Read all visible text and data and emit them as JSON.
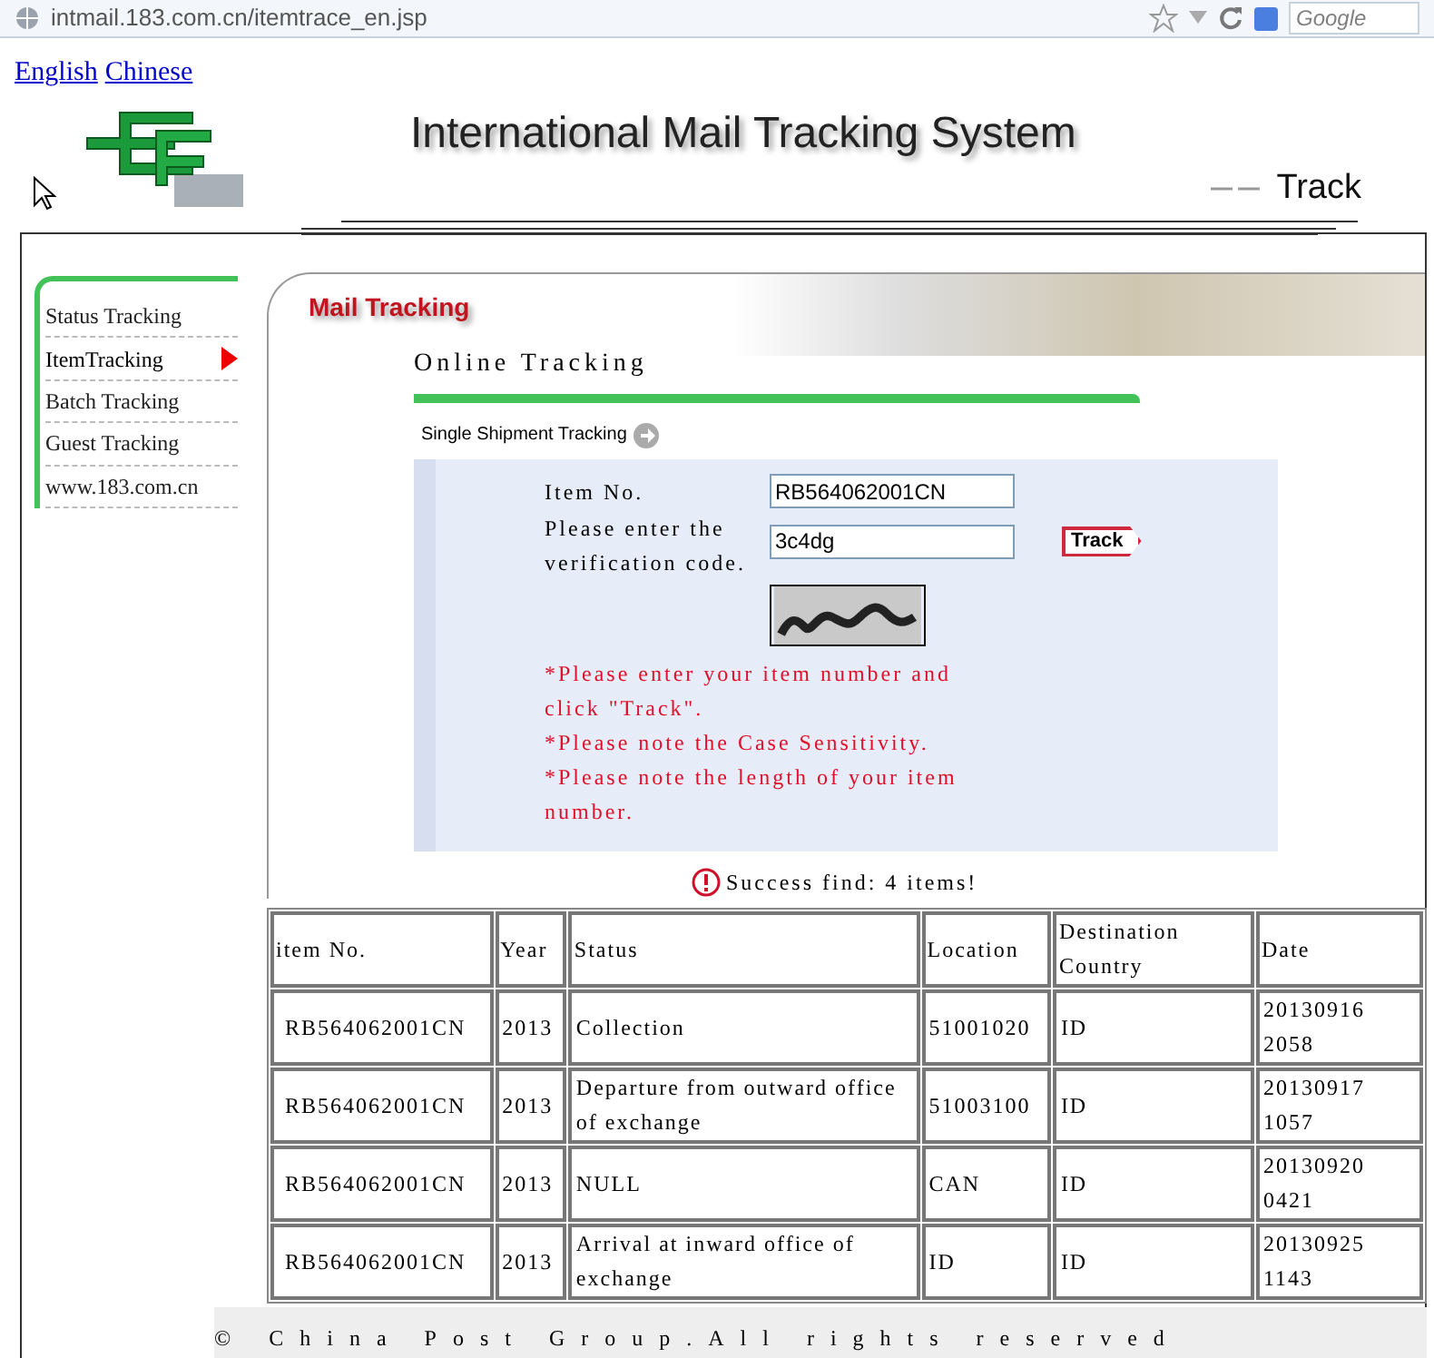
{
  "browser": {
    "url": "intmail.183.com.cn/itemtrace_en.jsp",
    "search_placeholder": "Google"
  },
  "language_links": [
    "English",
    "Chinese"
  ],
  "header": {
    "title": "International Mail Tracking System",
    "subtitle": "Track"
  },
  "sidebar": [
    {
      "label": "Status Tracking",
      "selected": false
    },
    {
      "label": "ItemTracking",
      "selected": true
    },
    {
      "label": "Batch Tracking",
      "selected": false
    },
    {
      "label": "Guest Tracking",
      "selected": false
    },
    {
      "label": "www.183.com.cn",
      "selected": false
    }
  ],
  "panel": {
    "title": "Mail Tracking",
    "section": "Online Tracking",
    "subsection": "Single Shipment Tracking"
  },
  "form": {
    "fields": [
      {
        "label": "Item No.",
        "value": "RB564062001CN"
      },
      {
        "label": "Please enter the verification code.",
        "value": "3c4dg"
      }
    ],
    "button": "Track",
    "notes": [
      "*Please enter your item number and click \"Track\".",
      "*Please note the Case Sensitivity.",
      "*Please note the length of your item number."
    ]
  },
  "result": "Success find: 4 items!",
  "table": {
    "columns": [
      "item No.",
      "Year",
      "Status",
      "Location",
      "Destination Country",
      "Date"
    ],
    "rows": [
      [
        "RB564062001CN",
        "2013",
        "Collection",
        "51001020",
        "ID",
        "20130916 2058"
      ],
      [
        "RB564062001CN",
        "2013",
        "Departure from outward office of exchange",
        "51003100",
        "ID",
        "20130917 1057"
      ],
      [
        "RB564062001CN",
        "2013",
        "NULL",
        "CAN",
        "ID",
        "20130920 0421"
      ],
      [
        "RB564062001CN",
        "2013",
        "Arrival at inward office of exchange",
        "ID",
        "ID",
        "20130925 1143"
      ]
    ]
  },
  "footer": "© China Post Group.All rights reserved"
}
